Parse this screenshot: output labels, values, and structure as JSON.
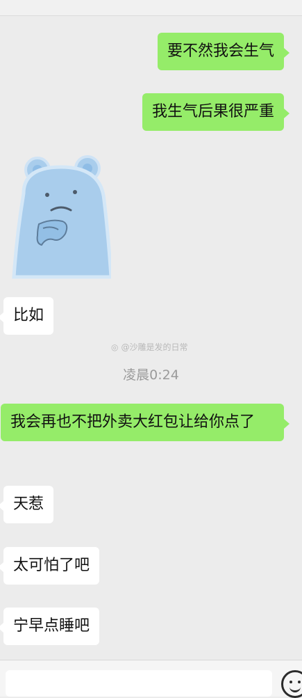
{
  "messages": [
    {
      "side": "sent",
      "text": "要不然我会生气"
    },
    {
      "side": "sent",
      "text": "我生气后果很严重"
    },
    {
      "side": "recv",
      "type": "sticker",
      "sticker": "blue-bear-thinking"
    },
    {
      "side": "recv",
      "text": "比如"
    },
    {
      "side": "sent",
      "text": "我会再也不把外卖大红包让给你点了"
    },
    {
      "side": "recv",
      "text": "天惹"
    },
    {
      "side": "recv",
      "text": "太可怕了吧"
    },
    {
      "side": "recv",
      "text": "宁早点睡吧"
    }
  ],
  "watermark": "@沙雕是发的日常",
  "timestamp": "凌晨0:24",
  "colors": {
    "sent_bubble": "#95ec69",
    "recv_bubble": "#ffffff",
    "background": "#ececec"
  }
}
